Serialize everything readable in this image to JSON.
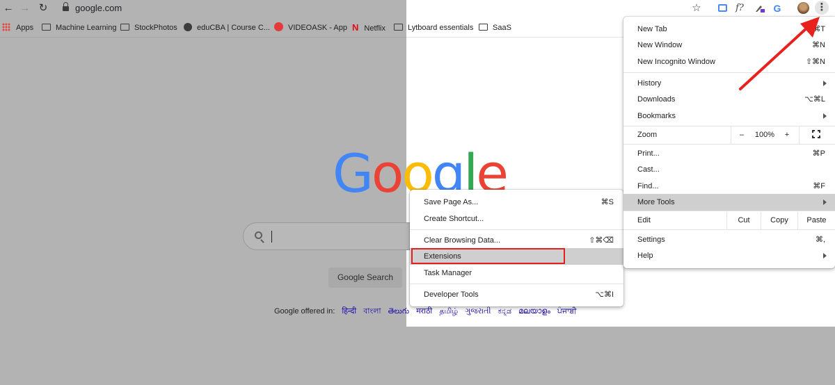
{
  "toolbar": {
    "back_icon": "←",
    "forward_icon": "→",
    "reload_icon": "↻",
    "url": "google.com",
    "star_icon": "☆",
    "ext_f": "f?",
    "menu_icon": "⋮"
  },
  "bookmarks": [
    {
      "label": "Apps"
    },
    {
      "label": "Machine Learning"
    },
    {
      "label": "StockPhotos"
    },
    {
      "label": "eduCBA | Course C..."
    },
    {
      "label": "VIDEOASK - App"
    },
    {
      "label": "Netflix"
    },
    {
      "label": "Lytboard essentials"
    },
    {
      "label": "SaaS"
    }
  ],
  "page": {
    "logo_letters": [
      "G",
      "o",
      "o",
      "g",
      "l",
      "e"
    ],
    "logo_colors": [
      "#4285f4",
      "#ea4335",
      "#fbbc05",
      "#4285f4",
      "#34a853",
      "#ea4335"
    ],
    "search_button": "Google Search",
    "offered_in": "Google offered in:",
    "languages": [
      "हिन्दी",
      "বাংলা",
      "తెలుగు",
      "मराठी",
      "தமிழ்",
      "ગુજરાતી",
      "ಕನ್ನಡ",
      "മലയാളം",
      "ਪੰਜਾਬੀ"
    ]
  },
  "main_menu": {
    "new_tab": "New Tab",
    "new_tab_sc": "⌘T",
    "new_window": "New Window",
    "new_window_sc": "⌘N",
    "new_incognito": "New Incognito Window",
    "new_incognito_sc": "⇧⌘N",
    "history": "History",
    "downloads": "Downloads",
    "downloads_sc": "⌥⌘L",
    "bookmarks": "Bookmarks",
    "zoom": "Zoom",
    "zoom_minus": "–",
    "zoom_value": "100%",
    "zoom_plus": "+",
    "print": "Print...",
    "print_sc": "⌘P",
    "cast": "Cast...",
    "find": "Find...",
    "find_sc": "⌘F",
    "more_tools": "More Tools",
    "edit": "Edit",
    "cut": "Cut",
    "copy": "Copy",
    "paste": "Paste",
    "settings": "Settings",
    "settings_sc": "⌘,",
    "help": "Help"
  },
  "more_tools_menu": {
    "save_page": "Save Page As...",
    "save_page_sc": "⌘S",
    "create_shortcut": "Create Shortcut...",
    "clear_data": "Clear Browsing Data...",
    "clear_data_sc": "⇧⌘⌫",
    "extensions": "Extensions",
    "task_manager": "Task Manager",
    "dev_tools": "Developer Tools",
    "dev_tools_sc": "⌥⌘I"
  },
  "colors": {
    "highlight_box": "#e02020",
    "annotation_arrow": "#e8201e",
    "link_blue": "#1a0dab"
  }
}
